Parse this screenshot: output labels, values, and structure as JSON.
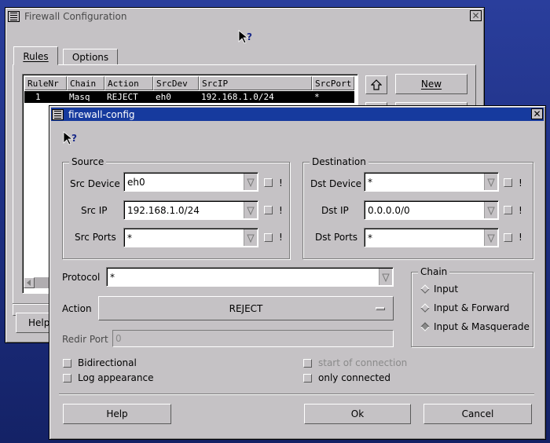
{
  "back_window": {
    "title": "Firewall Configuration",
    "tabs": [
      {
        "label": "Rules"
      },
      {
        "label": "Options"
      }
    ],
    "table": {
      "columns": [
        "RuleNr",
        "Chain",
        "Action",
        "SrcDev",
        "SrcIP",
        "SrcPort"
      ],
      "rows": [
        [
          "1",
          "Masq",
          "REJECT",
          "eh0",
          "192.168.1.0/24",
          "*"
        ]
      ]
    },
    "new_label": "New",
    "help_label": "Help"
  },
  "dialog": {
    "title": "firewall-config",
    "source": {
      "legend": "Source",
      "device_label": "Src Device",
      "device_value": "eh0",
      "ip_label": "Src IP",
      "ip_value": "192.168.1.0/24",
      "ports_label": "Src Ports",
      "ports_value": "*"
    },
    "destination": {
      "legend": "Destination",
      "device_label": "Dst Device",
      "device_value": "*",
      "ip_label": "Dst IP",
      "ip_value": "0.0.0.0/0",
      "ports_label": "Dst Ports",
      "ports_value": "*"
    },
    "negate_mark": "!",
    "protocol_label": "Protocol",
    "protocol_value": "*",
    "action_label": "Action",
    "action_value": "REJECT",
    "redir_label": "Redir Port",
    "redir_value": "0",
    "chain": {
      "legend": "Chain",
      "options": [
        {
          "label": "Input",
          "selected": false
        },
        {
          "label": "Input & Forward",
          "selected": false
        },
        {
          "label": "Input & Masquerade",
          "selected": true
        }
      ]
    },
    "checks": {
      "bidirectional": "Bidirectional",
      "log": "Log appearance",
      "start_conn": "start of connection",
      "only_conn": "only connected"
    },
    "buttons": {
      "help": "Help",
      "ok": "Ok",
      "cancel": "Cancel"
    }
  }
}
